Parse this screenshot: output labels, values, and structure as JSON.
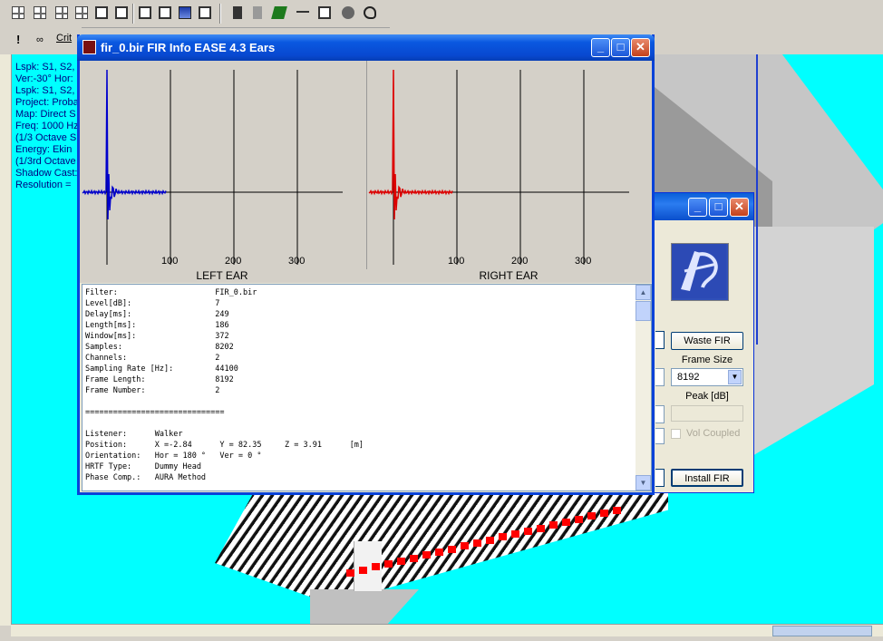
{
  "fir_window": {
    "title": "fir_0.bir FIR Info EASE 4.3 Ears",
    "left_ear_label": "LEFT EAR",
    "right_ear_label": "RIGHT EAR",
    "x_ticks": [
      "100",
      "200",
      "300"
    ],
    "text_lines": [
      "Filter:                     FIR_0.bir",
      "Level[dB]:                  7",
      "Delay[ms]:                  249",
      "Length[ms]:                 186",
      "Window[ms]:                 372",
      "Samples:                    8202",
      "Channels:                   2",
      "Sampling Rate [Hz]:         44100",
      "Frame Length:               8192",
      "Frame Number:               2",
      "",
      "==============================",
      "",
      "Listener:      Walker",
      "Position:      X =-2.84      Y = 82.35     Z = 3.91      [m]",
      "Orientation:   Hor = 180 °   Ver = 0 °",
      "HRTF Type:     Dummy Head",
      "Phase Comp.:   AURA Method",
      "",
      "=============================="
    ]
  },
  "back_dialog": {
    "waste_fir": "Waste FIR",
    "frame_size_label": "Frame Size",
    "frame_size_value": "8192",
    "peak_label": "Peak [dB]",
    "vol_coupled": "Vol Coupled",
    "install_fir": "Install FIR"
  },
  "info_panel": {
    "lines": [
      "Lspk: S1, S2,",
      "Ver:-30°  Hor:",
      "Lspk: S1, S2,",
      "Project: Proba",
      "Map: Direct S",
      "Freq: 1000 Hz",
      "(1/3 Octave S",
      "Energy: Ekin",
      "(1/3rd Octave",
      "Shadow Cast:",
      "Resolution ="
    ]
  },
  "toolbar": {
    "crit_label": "Crit",
    "exclaim_label": "!"
  },
  "colors": {
    "viewport_bg": "#00ffff",
    "left_signal": "#0000cc",
    "right_signal": "#dd0000",
    "title_blue": "#0a58e0"
  }
}
